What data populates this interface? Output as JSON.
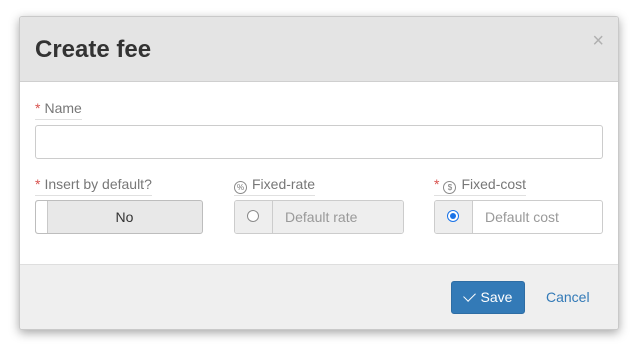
{
  "dialog": {
    "title": "Create fee",
    "close_glyph": "×"
  },
  "form": {
    "name": {
      "required_mark": "*",
      "label": "Name",
      "value": "",
      "placeholder": ""
    },
    "insert_by_default": {
      "required_mark": "*",
      "label": "Insert by default?",
      "toggle_text": "No",
      "checked": false
    },
    "fixed_rate": {
      "label": "Fixed-rate",
      "icon": "percent-circle-icon",
      "placeholder": "Default rate",
      "selected": false,
      "disabled": true
    },
    "fixed_cost": {
      "required_mark": "*",
      "label": "Fixed-cost",
      "icon": "dollar-circle-icon",
      "placeholder": "Default cost",
      "selected": true
    }
  },
  "footer": {
    "save_label": "Save",
    "save_icon": "check-icon",
    "cancel_label": "Cancel"
  },
  "colors": {
    "primary": "#337ab7",
    "required": "#d9534f",
    "radio_selected": "#1a73e8"
  }
}
